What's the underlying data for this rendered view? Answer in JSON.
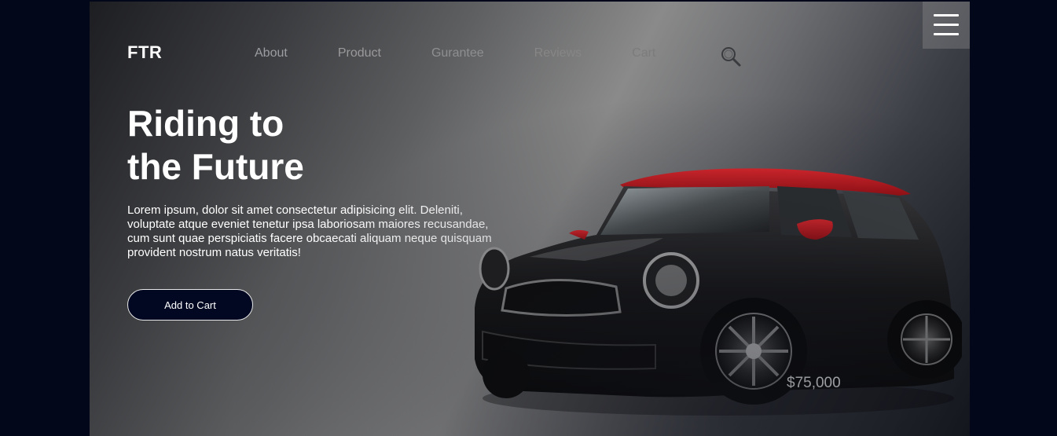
{
  "brand": {
    "logo": "FTR"
  },
  "nav": {
    "items": [
      {
        "label": "About"
      },
      {
        "label": "Product"
      },
      {
        "label": "Gurantee"
      },
      {
        "label": "Reviews"
      },
      {
        "label": "Cart"
      }
    ],
    "search_icon": "search-icon",
    "menu_icon": "hamburger-menu-icon"
  },
  "hero": {
    "title_line1": "Riding to",
    "title_line2": "the Future",
    "description": "Lorem ipsum, dolor sit amet consectetur adipisicing elit. Deleniti, voluptate atque eveniet tenetur ipsa laboriosam maiores recusandae, cum sunt quae perspiciatis facere obcaecati aliquam neque quisquam provident nostrum natus veritatis!",
    "cta_label": "Add to Cart"
  },
  "product": {
    "price": "$75,000",
    "colors": {
      "body": "#111111",
      "roof": "#c4161c",
      "accent_button": "#020822"
    }
  }
}
